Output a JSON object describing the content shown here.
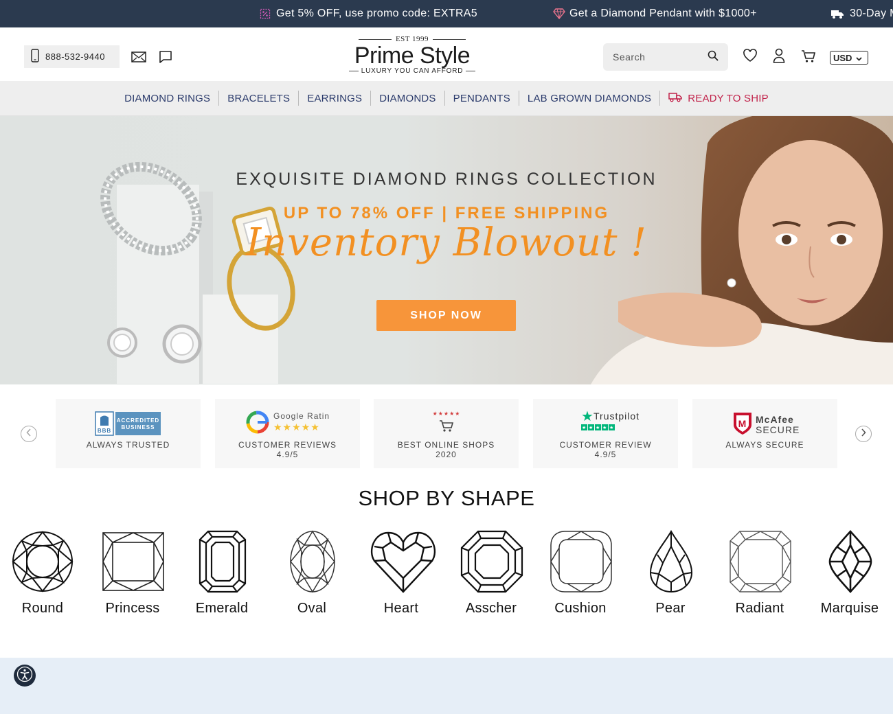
{
  "promo_bar": {
    "items": [
      {
        "icon": "percent-badge-icon",
        "text": "Get 5% OFF, use promo code: EXTRA5"
      },
      {
        "icon": "diamond-icon",
        "text": "Get a Diamond Pendant with $1000+"
      },
      {
        "icon": "truck-icon",
        "text": "30-Day M"
      }
    ],
    "colors": {
      "background": "#2b3a4f",
      "text": "#ffffff"
    }
  },
  "header": {
    "phone": "888-532-9440",
    "logo": {
      "est": "EST 1999",
      "name": "Prime Style",
      "tagline": "LUXURY YOU CAN AFFORD"
    },
    "search": {
      "placeholder": "Search"
    },
    "currency": "USD",
    "icons": [
      "phone-icon",
      "mail-icon",
      "chat-icon",
      "search-icon",
      "heart-icon",
      "user-icon",
      "cart-icon"
    ]
  },
  "nav": {
    "items": [
      {
        "label": "DIAMOND RINGS"
      },
      {
        "label": "BRACELETS"
      },
      {
        "label": "EARRINGS"
      },
      {
        "label": "DIAMONDS"
      },
      {
        "label": "PENDANTS"
      },
      {
        "label": "LAB GROWN DIAMONDS"
      },
      {
        "label": "READY TO SHIP",
        "icon": "truck-icon"
      }
    ],
    "colors": {
      "text": "#2a3a6b",
      "highlight": "#c1224a"
    }
  },
  "hero": {
    "title": "EXQUISITE DIAMOND RINGS COLLECTION",
    "subtitle": "UP TO 78% OFF | FREE SHIPPING",
    "script": "Inventory Blowout !",
    "button": "SHOP NOW",
    "colors": {
      "accent": "#f29022",
      "button": "#f7953a"
    }
  },
  "trust": {
    "cards": [
      {
        "logo_text": "ACCREDITED BUSINESS",
        "logo_mark": "BBB",
        "line1": "ALWAYS TRUSTED",
        "line2": ""
      },
      {
        "logo_text": "Google Rating",
        "logo_mark": "G",
        "line1": "CUSTOMER REVIEWS",
        "line2": "4.9/5"
      },
      {
        "logo_text": "★★★★★",
        "logo_mark": "cart",
        "line1": "BEST ONLINE SHOPS",
        "line2": "2020"
      },
      {
        "logo_text": "Trustpilot",
        "logo_mark": "★",
        "line1": "CUSTOMER REVIEW",
        "line2": "4.9/5"
      },
      {
        "logo_text": "McAfee",
        "logo_sub": "SECURE",
        "logo_mark": "M",
        "line1": "ALWAYS SECURE",
        "line2": ""
      }
    ]
  },
  "shapes": {
    "heading": "SHOP BY SHAPE",
    "items": [
      {
        "label": "Round",
        "icon": "round-diamond-icon"
      },
      {
        "label": "Princess",
        "icon": "princess-diamond-icon"
      },
      {
        "label": "Emerald",
        "icon": "emerald-diamond-icon"
      },
      {
        "label": "Oval",
        "icon": "oval-diamond-icon"
      },
      {
        "label": "Heart",
        "icon": "heart-diamond-icon"
      },
      {
        "label": "Asscher",
        "icon": "asscher-diamond-icon"
      },
      {
        "label": "Cushion",
        "icon": "cushion-diamond-icon"
      },
      {
        "label": "Pear",
        "icon": "pear-diamond-icon"
      },
      {
        "label": "Radiant",
        "icon": "radiant-diamond-icon"
      },
      {
        "label": "Marquise",
        "icon": "marquise-diamond-icon"
      }
    ]
  },
  "accessibility": {
    "icon": "accessibility-icon"
  }
}
